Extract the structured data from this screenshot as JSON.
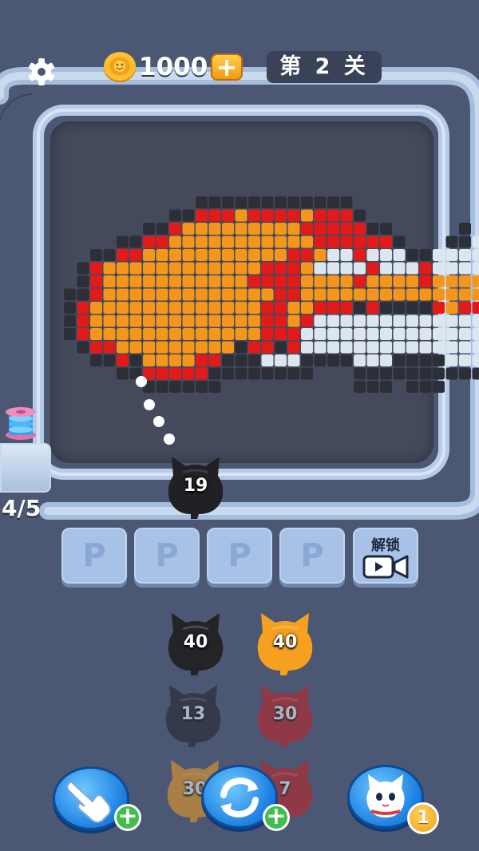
{
  "header": {
    "coin_value": "1000",
    "coin_plus_label": "+",
    "level_label": "第 2 关"
  },
  "icons": {
    "settings": "gear-icon",
    "coin": "coin-icon",
    "spool": "spool-icon",
    "video": "video-camera-icon",
    "hand": "tap-hand-icon",
    "shuffle": "refresh-arrows-icon",
    "cat_helper": "white-cat-icon"
  },
  "launcher": {
    "progress": "4/5",
    "active_cat": {
      "count": "19",
      "color": "#202025"
    }
  },
  "slots": {
    "items": [
      {
        "label": "P"
      },
      {
        "label": "P"
      },
      {
        "label": "P"
      },
      {
        "label": "P"
      }
    ],
    "unlock_label": "解锁"
  },
  "queue": {
    "cats": [
      {
        "count": "40",
        "color": "#232328",
        "state": "ready"
      },
      {
        "count": "40",
        "color": "#f5a11f",
        "state": "ready"
      },
      {
        "count": "13",
        "color": "#232328",
        "state": "dimmed"
      },
      {
        "count": "30",
        "color": "#c92222",
        "state": "dimmed"
      },
      {
        "count": "30",
        "color": "#f5a11f",
        "state": "dimmed"
      },
      {
        "count": "7",
        "color": "#c92222",
        "state": "dimmed"
      }
    ]
  },
  "buttons": {
    "hand_plus": "+",
    "shuffle_plus": "+",
    "cat_count": "1"
  },
  "colors": {
    "background": "#4c5774",
    "board": "#444a5c",
    "track": "#b7cbe6",
    "block_black": "#2c2f37",
    "block_orange": "#f5961c",
    "block_red": "#e31a1a",
    "block_white": "#dce6ee"
  }
}
